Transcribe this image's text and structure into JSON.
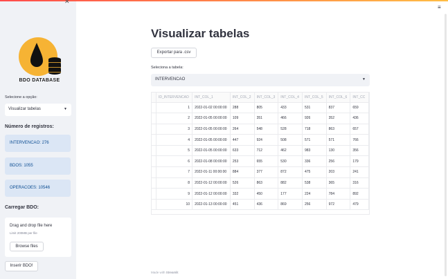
{
  "sidebar": {
    "logo_text": "BDO DATABASE",
    "select_label": "Selecione a opção:",
    "select_value": "Visualizar tabelas",
    "records_header": "Número de registros:",
    "records": [
      {
        "label": "INTERVENCAO: 276"
      },
      {
        "label": "BDOS: 1055"
      },
      {
        "label": "OPERACOES: 10546"
      }
    ],
    "upload_header": "Carregar BDO:",
    "upload_drag": "Drag and drop file here",
    "upload_limit": "Limit 200MB per file",
    "browse_label": "Browse files",
    "insert_label": "Inserir BDO!"
  },
  "main": {
    "title": "Visualizar tabelas",
    "export_label": "Exportar para .csv",
    "table_select_label": "Seleciona a tabela:",
    "table_select_value": "INTERVENCAO",
    "columns": [
      "",
      "ID_INTERVENCAO",
      "INT_COL_1",
      "INT_COL_2",
      "INT_COL_3",
      "INT_COL_4",
      "INT_COL_5",
      "INT_COL_6",
      "INT_CC"
    ],
    "rows": [
      [
        "1",
        "",
        "2022-01-02 00:00:00",
        "288",
        "805",
        "433",
        "531",
        "837",
        "659"
      ],
      [
        "2",
        "",
        "2022-01-05 00:00:00",
        "109",
        "351",
        "466",
        "926",
        "352",
        "436"
      ],
      [
        "3",
        "",
        "2022-01-05 00:00:00",
        "264",
        "548",
        "528",
        "718",
        "863",
        "657"
      ],
      [
        "4",
        "",
        "2022-01-05 00:00:00",
        "447",
        "924",
        "508",
        "571",
        "571",
        "766"
      ],
      [
        "5",
        "",
        "2022-01-05 00:00:00",
        "633",
        "712",
        "462",
        "983",
        "130",
        "356"
      ],
      [
        "6",
        "",
        "2022-01-08 00:00:00",
        "253",
        "655",
        "530",
        "336",
        "256",
        "179"
      ],
      [
        "7",
        "",
        "2022-01-11 00:00:00",
        "884",
        "377",
        "872",
        "475",
        "203",
        "241"
      ],
      [
        "8",
        "",
        "2022-01-12 00:00:00",
        "526",
        "863",
        "882",
        "538",
        "365",
        "316"
      ],
      [
        "9",
        "",
        "2022-01-12 00:00:00",
        "332",
        "450",
        "177",
        "224",
        "784",
        "892"
      ],
      [
        "10",
        "",
        "2022-01-13 00:00:00",
        "451",
        "436",
        "869",
        "256",
        "972",
        "479"
      ]
    ],
    "footer_prefix": "Made with",
    "footer_brand": "Streamlit"
  },
  "colors": {
    "accent_red": "#ff4b4b",
    "info_bg": "#dbe6f5",
    "info_text": "#0a4b91",
    "logo_orange": "#f6b334"
  },
  "icons": [
    "close-icon",
    "hamburger-menu-icon",
    "chevron-down-icon",
    "oil-drop-database-logo"
  ]
}
